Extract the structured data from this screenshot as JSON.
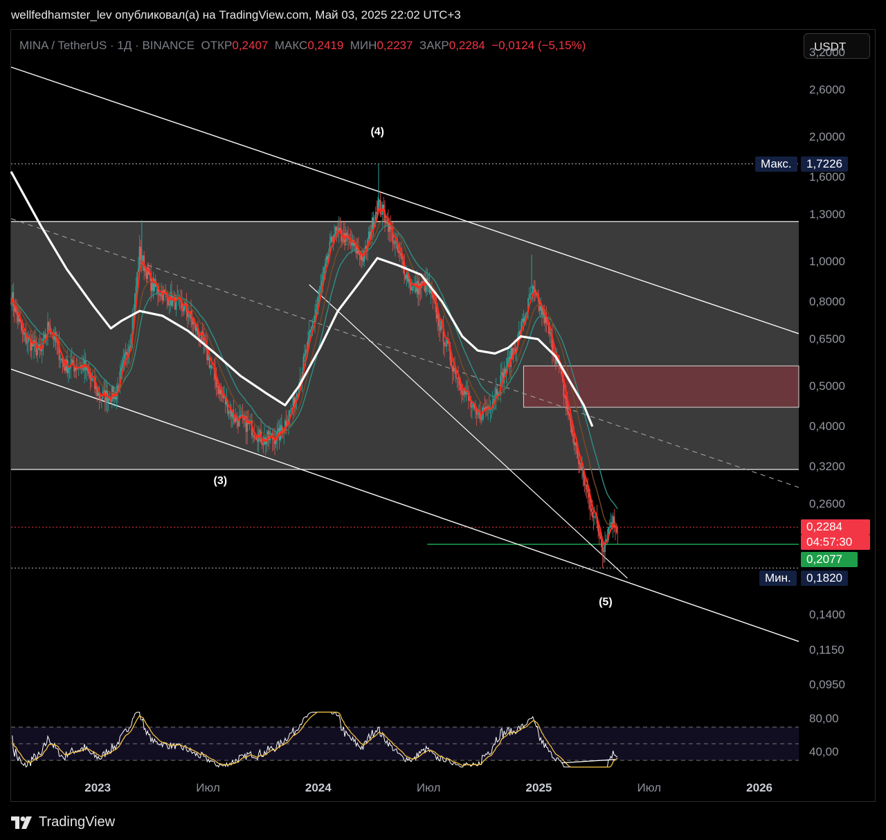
{
  "header": {
    "author_line": "wellfedhamster_lev опубликовал(а) на TradingView.com, Май 03, 2025 22:02 UTC+3"
  },
  "legend": {
    "symbol": "MINA / TetherUS · 1Д · BINANCE",
    "open_label": "ОТКР",
    "open": "0,2407",
    "high_label": "МАКС",
    "high": "0,2419",
    "low_label": "МИН",
    "low": "0,2237",
    "close_label": "ЗАКР",
    "close": "0,2284",
    "change": "−0,0124 (−5,15%)"
  },
  "currency_button": "USDT",
  "price_axis": {
    "ticks": [
      "3,2000",
      "2,6000",
      "2,0000",
      "1,6000",
      "1,3000",
      "1,0000",
      "0,8000",
      "0,6500",
      "0,5000",
      "0,4000",
      "0,3200",
      "0,2600",
      "0,1400",
      "0,1150",
      "0,0950"
    ]
  },
  "rsi_axis": {
    "ticks": [
      "80,00",
      "40,00"
    ]
  },
  "tags": {
    "max_label": "Макс.",
    "max_value": "1,7226",
    "current_price": "0,2284",
    "countdown": "04:57:30",
    "support": "0,2077",
    "min_label": "Мин.",
    "min_value": "0,1820"
  },
  "colors": {
    "up": "#26a69a",
    "down": "#ef5350",
    "ema_fast": "#ff2a1a",
    "ema_slow": "#7a4a26",
    "ema_mid": "#2f8f84",
    "ma200": "#ffffff",
    "zone": "#3b3b3b",
    "supply": "#6a373c",
    "support": "#22c55e",
    "accent": "#f23645",
    "tag_navy": "#132042"
  },
  "time_axis": {
    "labels": [
      {
        "text": "2023",
        "kind": "year",
        "pos": 0.11
      },
      {
        "text": "Июл",
        "kind": "month",
        "pos": 0.25
      },
      {
        "text": "2024",
        "kind": "year",
        "pos": 0.39
      },
      {
        "text": "Июл",
        "kind": "month",
        "pos": 0.53
      },
      {
        "text": "2025",
        "kind": "year",
        "pos": 0.67
      },
      {
        "text": "Июл",
        "kind": "month",
        "pos": 0.81
      },
      {
        "text": "2026",
        "kind": "year",
        "pos": 0.95
      }
    ]
  },
  "waves": [
    {
      "text": "(4)",
      "date": "2024-03-10",
      "price": 2.05
    },
    {
      "text": "(3)",
      "date": "2023-06-10",
      "price": 0.295
    },
    {
      "text": "(5)",
      "date": "2025-04-12",
      "price": 0.15
    }
  ],
  "chart_data": {
    "type": "line",
    "symbol": "MINA / TetherUS",
    "interval": "1Д",
    "exchange": "BINANCE",
    "y_scale": "log",
    "ylim": [
      0.085,
      3.4
    ],
    "xlim": [
      "2022-06-10",
      "2026-03-15"
    ],
    "ohlc": {
      "open": 0.2407,
      "high": 0.2419,
      "low": 0.2237,
      "close": 0.2284,
      "change": -0.0124,
      "change_pct": -5.15
    },
    "price_series": {
      "name": "",
      "points": [
        [
          "2022-06-10",
          0.83
        ],
        [
          "2022-07-01",
          0.66
        ],
        [
          "2022-08-01",
          0.6
        ],
        [
          "2022-08-15",
          0.71
        ],
        [
          "2022-09-10",
          0.56
        ],
        [
          "2022-10-15",
          0.56
        ],
        [
          "2022-11-12",
          0.47
        ],
        [
          "2022-12-10",
          0.48
        ],
        [
          "2023-01-05",
          0.66
        ],
        [
          "2023-01-20",
          1.05
        ],
        [
          "2023-02-10",
          0.88
        ],
        [
          "2023-03-10",
          0.82
        ],
        [
          "2023-04-10",
          0.77
        ],
        [
          "2023-05-10",
          0.64
        ],
        [
          "2023-06-10",
          0.48
        ],
        [
          "2023-07-05",
          0.42
        ],
        [
          "2023-08-01",
          0.4
        ],
        [
          "2023-08-25",
          0.37
        ],
        [
          "2023-09-20",
          0.38
        ],
        [
          "2023-10-15",
          0.45
        ],
        [
          "2023-11-10",
          0.63
        ],
        [
          "2023-12-01",
          0.85
        ],
        [
          "2023-12-25",
          1.18
        ],
        [
          "2024-01-20",
          1.12
        ],
        [
          "2024-02-15",
          1.02
        ],
        [
          "2024-03-10",
          1.38
        ],
        [
          "2024-03-25",
          1.28
        ],
        [
          "2024-04-15",
          1.05
        ],
        [
          "2024-05-10",
          0.86
        ],
        [
          "2024-06-05",
          0.88
        ],
        [
          "2024-06-25",
          0.72
        ],
        [
          "2024-07-20",
          0.56
        ],
        [
          "2024-08-10",
          0.48
        ],
        [
          "2024-08-30",
          0.42
        ],
        [
          "2024-09-25",
          0.46
        ],
        [
          "2024-10-20",
          0.55
        ],
        [
          "2024-11-10",
          0.65
        ],
        [
          "2024-12-05",
          0.85
        ],
        [
          "2024-12-25",
          0.74
        ],
        [
          "2025-01-20",
          0.56
        ],
        [
          "2025-02-10",
          0.4
        ],
        [
          "2025-03-01",
          0.31
        ],
        [
          "2025-03-20",
          0.25
        ],
        [
          "2025-04-08",
          0.205
        ],
        [
          "2025-04-22",
          0.238
        ],
        [
          "2025-05-03",
          0.2284
        ]
      ]
    },
    "ma200": {
      "name": "",
      "points": [
        [
          "2022-06-10",
          1.65
        ],
        [
          "2022-08-01",
          1.22
        ],
        [
          "2022-09-15",
          0.96
        ],
        [
          "2022-11-01",
          0.78
        ],
        [
          "2022-12-01",
          0.69
        ],
        [
          "2022-12-20",
          0.72
        ],
        [
          "2023-01-20",
          0.76
        ],
        [
          "2023-03-01",
          0.74
        ],
        [
          "2023-04-15",
          0.68
        ],
        [
          "2023-06-01",
          0.6
        ],
        [
          "2023-07-15",
          0.53
        ],
        [
          "2023-08-30",
          0.48
        ],
        [
          "2023-10-01",
          0.45
        ],
        [
          "2023-10-25",
          0.5
        ],
        [
          "2023-12-01",
          0.62
        ],
        [
          "2024-01-01",
          0.76
        ],
        [
          "2024-02-05",
          0.88
        ],
        [
          "2024-03-10",
          1.02
        ],
        [
          "2024-04-15",
          0.98
        ],
        [
          "2024-05-25",
          0.93
        ],
        [
          "2024-07-01",
          0.8
        ],
        [
          "2024-08-05",
          0.66
        ],
        [
          "2024-09-01",
          0.61
        ],
        [
          "2024-10-01",
          0.6
        ],
        [
          "2024-10-25",
          0.62
        ],
        [
          "2024-11-15",
          0.66
        ],
        [
          "2024-12-15",
          0.65
        ],
        [
          "2025-01-15",
          0.59
        ],
        [
          "2025-02-10",
          0.51
        ],
        [
          "2025-03-05",
          0.45
        ],
        [
          "2025-03-20",
          0.4
        ]
      ]
    },
    "resistance_zone": [
      0.315,
      1.25
    ],
    "supply_zone": [
      0.445,
      0.56
    ],
    "levels": {
      "max": 1.7226,
      "min": 0.182,
      "support": 0.2077,
      "current": 0.2284
    },
    "channel_upper": [
      [
        "2022-06-10",
        2.95
      ],
      [
        "2026-03-15",
        0.67
      ]
    ],
    "channel_lower": [
      [
        "2022-06-10",
        0.55
      ],
      [
        "2026-03-15",
        0.121
      ]
    ],
    "channel_mid": [
      [
        "2022-06-10",
        1.27
      ],
      [
        "2026-03-15",
        0.285
      ]
    ],
    "inner_trendline": [
      [
        "2023-11-12",
        0.88
      ],
      [
        "2025-05-20",
        0.172
      ]
    ],
    "rsi": {
      "upper": 70,
      "lower": 30,
      "ticks": [
        80,
        40
      ]
    }
  }
}
